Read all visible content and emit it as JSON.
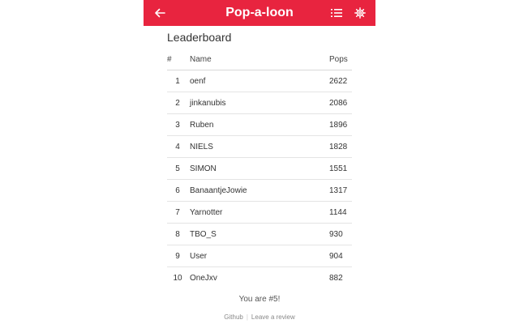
{
  "header": {
    "title": "Pop-a-loon",
    "back_icon": "back-arrow-icon",
    "list_icon": "list-icon",
    "settings_icon": "gear-icon",
    "color": "#e8243f"
  },
  "leaderboard": {
    "title": "Leaderboard",
    "columns": [
      "#",
      "Name",
      "Pops"
    ],
    "rows": [
      {
        "rank": "1",
        "name": "oenf",
        "pops": "2622"
      },
      {
        "rank": "2",
        "name": "jinkanubis",
        "pops": "2086"
      },
      {
        "rank": "3",
        "name": "Ruben",
        "pops": "1896"
      },
      {
        "rank": "4",
        "name": "NIELS",
        "pops": "1828"
      },
      {
        "rank": "5",
        "name": "SIMON",
        "pops": "1551"
      },
      {
        "rank": "6",
        "name": "BanaantjeJowie",
        "pops": "1317"
      },
      {
        "rank": "7",
        "name": "Yarnotter",
        "pops": "1144"
      },
      {
        "rank": "8",
        "name": "TBO_S",
        "pops": "930"
      },
      {
        "rank": "9",
        "name": "User",
        "pops": "904"
      },
      {
        "rank": "10",
        "name": "OneJxv",
        "pops": "882"
      }
    ]
  },
  "status": {
    "you_are": "You are #5!"
  },
  "footer": {
    "github": "Github",
    "separator": "|",
    "review": "Leave a review"
  }
}
